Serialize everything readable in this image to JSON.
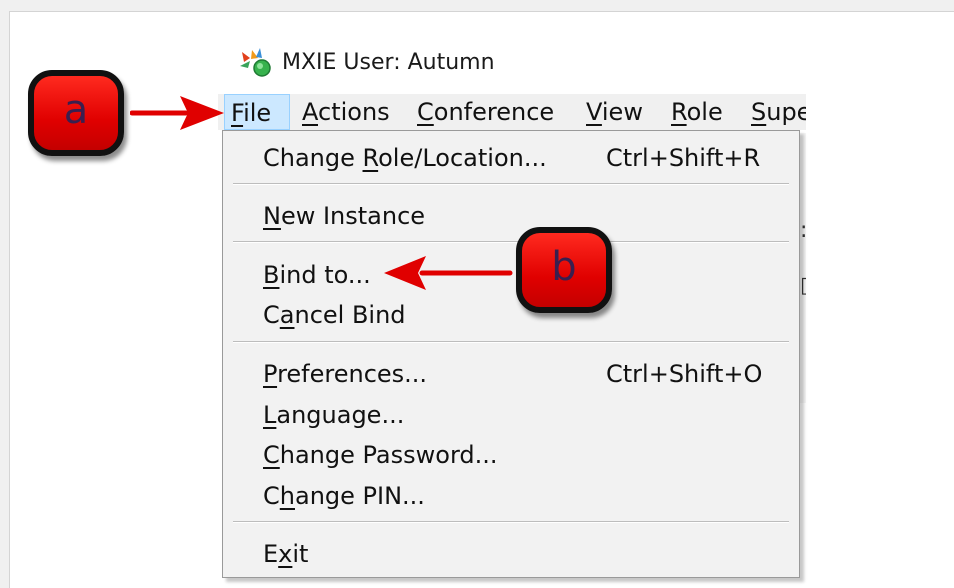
{
  "window": {
    "title": "MXIE User: Autumn"
  },
  "menubar": {
    "items": [
      {
        "pre": "",
        "ul": "F",
        "post": "ile"
      },
      {
        "pre": "",
        "ul": "A",
        "post": "ctions"
      },
      {
        "pre": "",
        "ul": "C",
        "post": "onference"
      },
      {
        "pre": "",
        "ul": "V",
        "post": "iew"
      },
      {
        "pre": "",
        "ul": "R",
        "post": "ole"
      },
      {
        "pre": "",
        "ul": "S",
        "post": "upe"
      }
    ]
  },
  "file_menu": {
    "items": [
      {
        "pre": "Change ",
        "ul": "R",
        "post": "ole/Location...",
        "shortcut": "Ctrl+Shift+R"
      },
      {
        "pre": "",
        "ul": "N",
        "post": "ew Instance",
        "shortcut": ""
      },
      {
        "pre": "",
        "ul": "B",
        "post": "ind to...",
        "shortcut": ""
      },
      {
        "pre": "C",
        "ul": "a",
        "post": "ncel Bind",
        "shortcut": ""
      },
      {
        "pre": "",
        "ul": "P",
        "post": "references...",
        "shortcut": "Ctrl+Shift+O"
      },
      {
        "pre": "",
        "ul": "L",
        "post": "anguage...",
        "shortcut": ""
      },
      {
        "pre": "",
        "ul": "C",
        "post": "hange Password...",
        "shortcut": ""
      },
      {
        "pre": "C",
        "ul": "h",
        "post": "ange PIN...",
        "shortcut": ""
      },
      {
        "pre": "E",
        "ul": "x",
        "post": "it",
        "shortcut": ""
      }
    ]
  },
  "annotations": {
    "a": "a",
    "b": "b"
  },
  "colors": {
    "badge": "#e00000",
    "arrow": "#e00000",
    "menu_open_highlight": "#cce8ff"
  },
  "icons": {
    "app": "mxie-app-icon",
    "arrow_a": "right-arrow-icon",
    "arrow_b": "left-arrow-icon"
  }
}
